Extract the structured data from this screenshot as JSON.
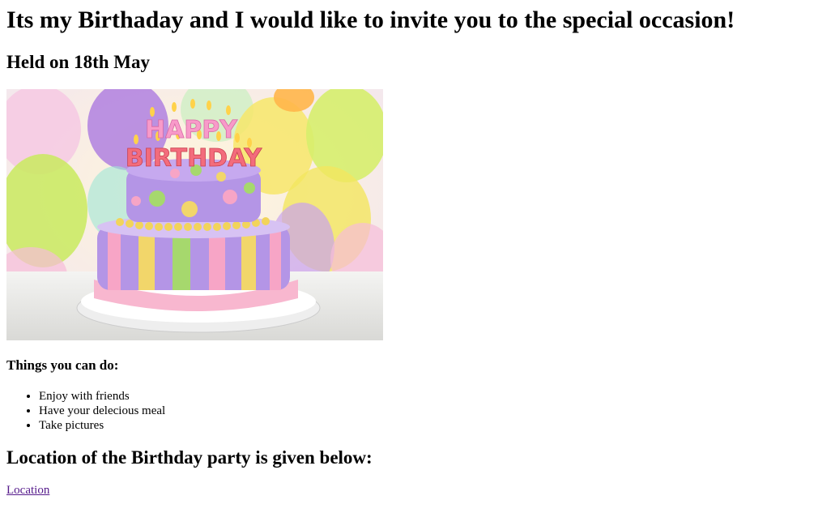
{
  "page": {
    "title": "Its my Birthaday and I would like to invite you to the special occasion!",
    "date_heading": "Held on 18th May",
    "image": {
      "description_icon": "birthday-cake-photo",
      "topper_line1": "HAPPY",
      "topper_line2": "BIRTHDAY"
    },
    "things_heading": "Things you can do:",
    "things": [
      "Enjoy with friends",
      "Have your delecious meal",
      "Take pictures"
    ],
    "location_heading": "Location of the Birthday party is given below:",
    "location_link": "Location"
  },
  "colors": {
    "link_visited": "#551a8b"
  }
}
